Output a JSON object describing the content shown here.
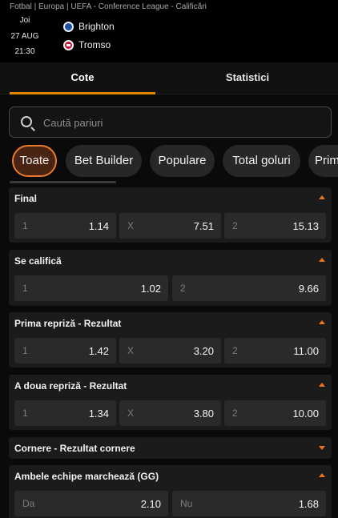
{
  "breadcrumb": "Fotbal | Europa | UEFA - Conference League - Calificări",
  "match": {
    "day": "Joi",
    "date": "27 AUG",
    "time": "21:30",
    "home": "Brighton",
    "away": "Tromso",
    "home_icon": "brighton-crest-icon",
    "away_icon": "tromso-crest-icon"
  },
  "tabs": [
    "Cote",
    "Statistici"
  ],
  "search": {
    "placeholder": "Caută pariuri",
    "icon": "search-icon"
  },
  "chips": [
    "Toate",
    "Bet Builder",
    "Populare",
    "Total goluri",
    "Prima repriză"
  ],
  "colors": {
    "accent": "#e9731f",
    "tab_underline": "#e08a00",
    "background": "#0a0a0a",
    "card": "#1b1b1b",
    "odd_box": "#2a2a2a"
  },
  "markets": [
    {
      "title": "Final",
      "expanded": true,
      "odds": [
        {
          "label": "1",
          "value": "1.14"
        },
        {
          "label": "X",
          "value": "7.51"
        },
        {
          "label": "2",
          "value": "15.13"
        }
      ]
    },
    {
      "title": "Se califică",
      "expanded": true,
      "odds": [
        {
          "label": "1",
          "value": "1.02"
        },
        {
          "label": "2",
          "value": "9.66"
        }
      ]
    },
    {
      "title": "Prima repriză - Rezultat",
      "expanded": true,
      "odds": [
        {
          "label": "1",
          "value": "1.42"
        },
        {
          "label": "X",
          "value": "3.20"
        },
        {
          "label": "2",
          "value": "11.00"
        }
      ]
    },
    {
      "title": "A doua repriză - Rezultat",
      "expanded": true,
      "odds": [
        {
          "label": "1",
          "value": "1.34"
        },
        {
          "label": "X",
          "value": "3.80"
        },
        {
          "label": "2",
          "value": "10.00"
        }
      ]
    },
    {
      "title": "Cornere - Rezultat cornere",
      "expanded": false,
      "odds": []
    },
    {
      "title": "Ambele echipe marchează (GG)",
      "expanded": true,
      "odds": [
        {
          "label": "Da",
          "value": "2.10"
        },
        {
          "label": "Nu",
          "value": "1.68"
        }
      ]
    }
  ]
}
